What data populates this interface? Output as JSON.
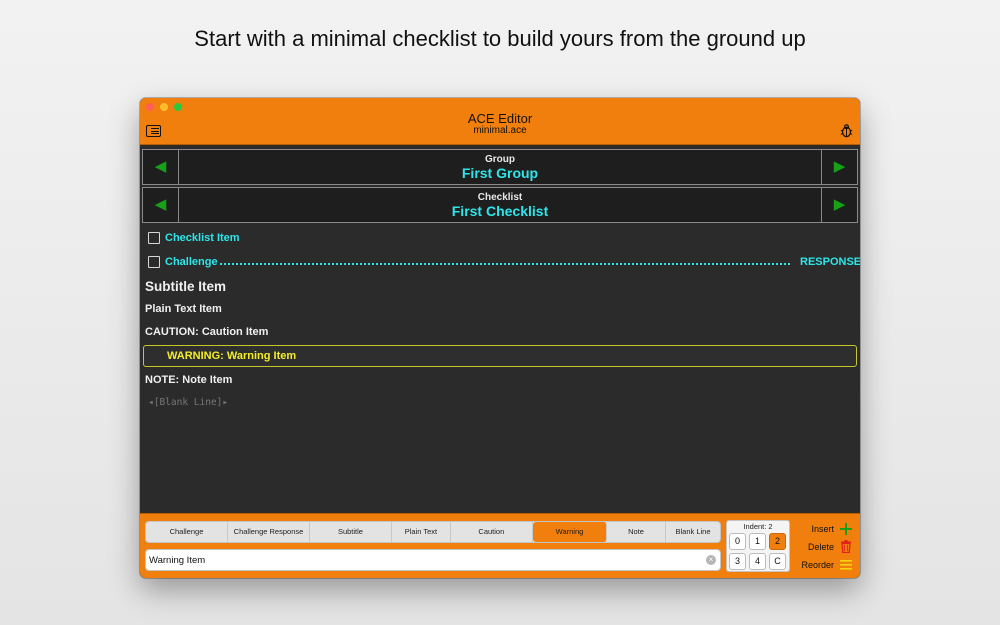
{
  "headline": "Start with a minimal checklist to build yours from the ground up",
  "window": {
    "title": "ACE Editor",
    "subtitle": "minimal.ace"
  },
  "icons": {
    "sidebar": "sidebar-toggle-icon",
    "bug": "bug-icon",
    "prev": "triangle-left",
    "next": "triangle-right",
    "insert": "plus-icon",
    "delete": "trash-icon",
    "reorder": "reorder-lines-icon"
  },
  "group": {
    "label": "Group",
    "value": "First Group"
  },
  "checklist": {
    "label": "Checklist",
    "value": "First Checklist"
  },
  "items": {
    "checklist_item": "Checklist Item",
    "challenge": "Challenge",
    "response": "RESPONSE",
    "subtitle": "Subtitle Item",
    "plain_text": "Plain Text Item",
    "caution": "CAUTION: Caution Item",
    "warning": "WARNING: Warning Item",
    "note": "NOTE: Note Item",
    "blank_line": "◂[Blank Line]▸"
  },
  "item_types": [
    "Challenge",
    "Challenge Response",
    "Subtitle",
    "Plain Text",
    "Caution",
    "Warning",
    "Note",
    "Blank Line"
  ],
  "selected_type": "Warning",
  "text_field": {
    "value": "Warning Item"
  },
  "indent": {
    "label": "Indent: 2",
    "buttons": [
      "0",
      "1",
      "2",
      "3",
      "4",
      "C"
    ],
    "selected": "2"
  },
  "actions": {
    "insert": "Insert",
    "delete": "Delete",
    "reorder": "Reorder"
  },
  "colors": {
    "accent": "#f07f0e",
    "cyan": "#2ee6ea",
    "warning": "#f2ee2a",
    "arrow_green": "#16a116",
    "background": "#2b2b2b"
  }
}
